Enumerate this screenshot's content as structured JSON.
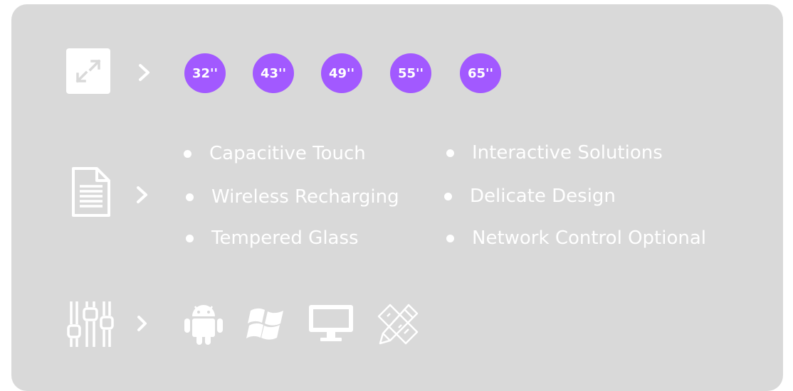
{
  "rows": {
    "sizes": {
      "icon": "resize-arrows-icon",
      "chevron_icon": "chevron-right-icon",
      "options": [
        "32''",
        "43''",
        "49''",
        "55''",
        "65''"
      ]
    },
    "features": {
      "icon": "document-icon",
      "chevron_icon": "chevron-right-icon",
      "items": [
        "Capacitive Touch",
        "Interactive Solutions",
        "Wireless Recharging",
        "Delicate Design",
        "Tempered Glass",
        "Network Control Optional"
      ]
    },
    "systems": {
      "icon": "settings-sliders-icon",
      "chevron_icon": "chevron-right-icon",
      "icons": [
        "android-icon",
        "windows-icon",
        "monitor-icon",
        "design-tools-icon"
      ]
    }
  },
  "colors": {
    "card_background": "#d9d9d9",
    "badge": "#a259ff",
    "foreground": "#ffffff"
  }
}
